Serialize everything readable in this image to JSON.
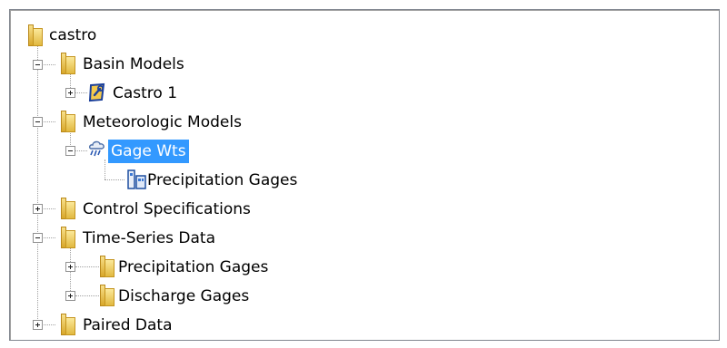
{
  "tree": {
    "root": {
      "label": "castro",
      "icon": "folder-icon"
    },
    "basin_models": {
      "label": "Basin Models",
      "icon": "folder-icon",
      "expanded": true
    },
    "castro_1": {
      "label": "Castro 1",
      "icon": "basin-model-icon",
      "expanded": false
    },
    "met_models": {
      "label": "Meteorologic Models",
      "icon": "folder-icon",
      "expanded": true
    },
    "gage_wts": {
      "label": "Gage Wts",
      "icon": "meteorologic-model-icon",
      "expanded": true,
      "selected": true
    },
    "precip_gages_child": {
      "label": "Precipitation Gages",
      "icon": "precipitation-gages-icon"
    },
    "control_specs": {
      "label": "Control Specifications",
      "icon": "folder-icon",
      "expanded": false
    },
    "time_series": {
      "label": "Time-Series Data",
      "icon": "folder-icon",
      "expanded": true
    },
    "ts_precip": {
      "label": "Precipitation Gages",
      "icon": "folder-icon",
      "expanded": false
    },
    "ts_discharge": {
      "label": "Discharge Gages",
      "icon": "folder-icon",
      "expanded": false
    },
    "paired_data": {
      "label": "Paired Data",
      "icon": "folder-icon",
      "expanded": false
    }
  },
  "colors": {
    "selection": "#3399ff",
    "folder": "#e8c24a"
  }
}
